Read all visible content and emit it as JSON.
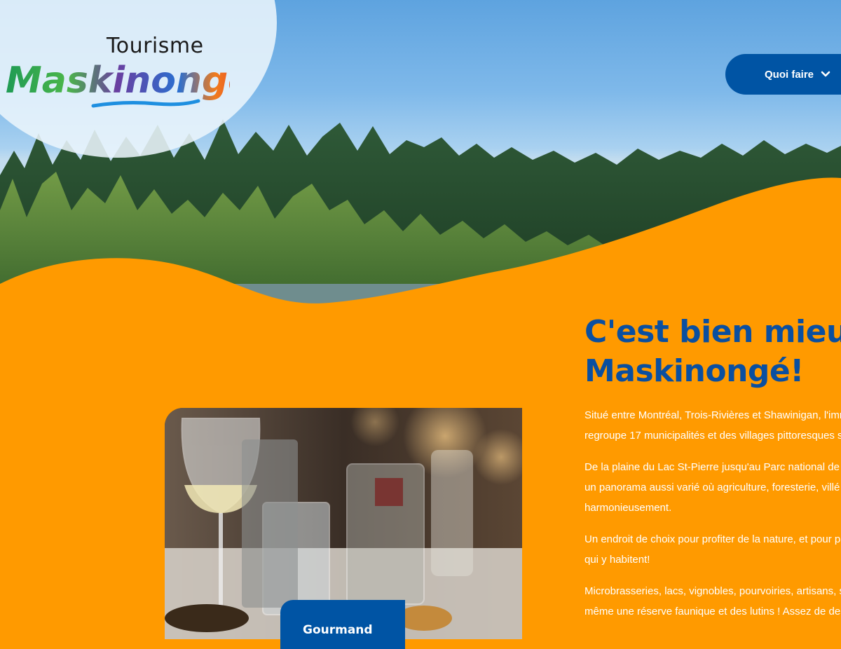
{
  "logo": {
    "top_word": "Tourisme",
    "main_word": "Maskinongé"
  },
  "nav": {
    "label": "Quoi faire",
    "icon": "chevron-down-icon"
  },
  "intro": {
    "headline_line1": "C'est bien mieu",
    "headline_line2": "Maskinongé!",
    "paragraphs": [
      {
        "line1": "Situé entre Montréal, Trois-Rivières et Shawinigan, l'imm",
        "line2": "regroupe 17 municipalités et des villages pittoresques s"
      },
      {
        "line1": "De la plaine du Lac St-Pierre jusqu'au Parc national de l",
        "line2": "un panorama aussi varié où agriculture, foresterie, villé",
        "line3": "harmonieusement."
      },
      {
        "line1": "Un endroit de choix pour profiter de la nature, et pour p",
        "line2": "qui y habitent!"
      },
      {
        "line1": "Microbrasseries, lacs, vignobles, pourvoiries, artisans, s",
        "line2": "même une réserve faunique et des lutins ! Assez de des"
      }
    ]
  },
  "card": {
    "tag": "Gourmand"
  },
  "colors": {
    "brand_blue": "#0054a4",
    "headline_blue": "#0a4fa0",
    "orange": "#ff9a00"
  }
}
